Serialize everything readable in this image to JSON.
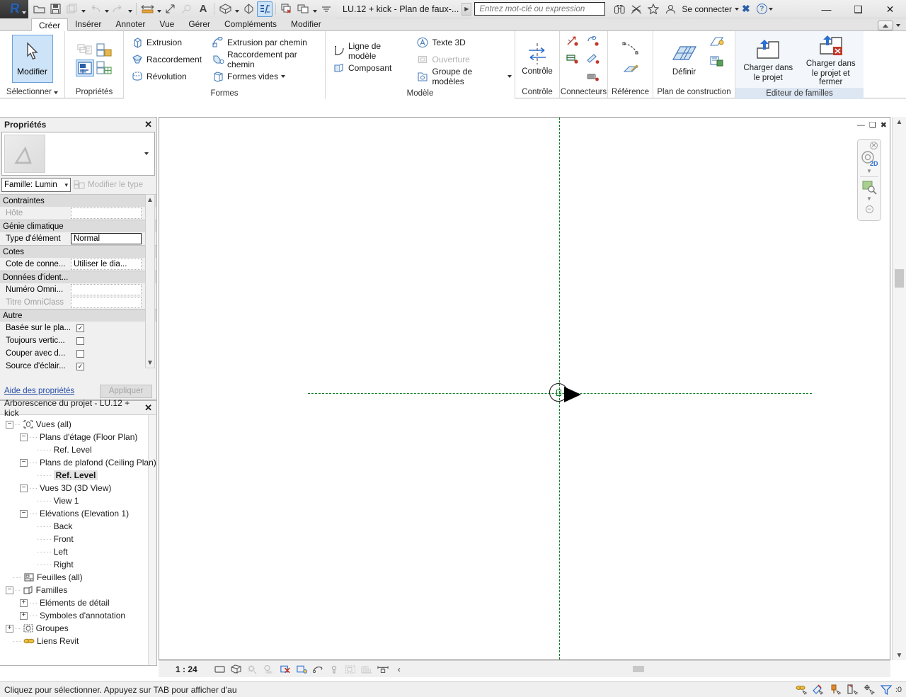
{
  "app": {
    "logo_glyph": "R",
    "document_title": "LU.12 + kick - Plan de faux-...",
    "sign_in_label": "Se connecter"
  },
  "quick_access": {
    "items": [
      {
        "name": "open-icon",
        "glyph": "⦗",
        "state": "enabled"
      },
      {
        "name": "save-icon",
        "glyph": "ὋE",
        "state": "enabled"
      },
      {
        "name": "save-as-icon",
        "glyph": "⎘",
        "state": "disabled"
      },
      {
        "name": "undo-icon",
        "glyph": "↶",
        "state": "disabled"
      },
      {
        "name": "redo-icon",
        "glyph": "↷",
        "state": "disabled"
      },
      {
        "name": "measure-icon",
        "glyph": "↔",
        "state": "enabled"
      },
      {
        "name": "aligned-dimension-icon",
        "glyph": "⤡",
        "state": "enabled"
      },
      {
        "name": "tag-icon",
        "glyph": "ⓘ",
        "state": "disabled"
      },
      {
        "name": "text-icon",
        "glyph": "A",
        "state": "enabled"
      },
      {
        "name": "default-3d-view-icon",
        "glyph": "⬡",
        "state": "enabled"
      },
      {
        "name": "section-icon",
        "glyph": "⬡",
        "state": "enabled"
      },
      {
        "name": "thin-lines-icon",
        "glyph": "≡",
        "state": "selected"
      },
      {
        "name": "close-hidden-windows-icon",
        "glyph": "❐",
        "state": "enabled"
      },
      {
        "name": "switch-windows-icon",
        "glyph": "⧉",
        "state": "enabled"
      }
    ]
  },
  "search": {
    "placeholder": "Entrez mot-clé ou expression",
    "value": ""
  },
  "tabs": {
    "items": [
      {
        "label": "Créer",
        "active": true
      },
      {
        "label": "Insérer",
        "active": false
      },
      {
        "label": "Annoter",
        "active": false
      },
      {
        "label": "Vue",
        "active": false
      },
      {
        "label": "Gérer",
        "active": false
      },
      {
        "label": "Compléments",
        "active": false
      },
      {
        "label": "Modifier",
        "active": false
      }
    ]
  },
  "ribbon": {
    "panels": [
      {
        "title": "Sélectionner",
        "has_dropdown": true,
        "big_button": {
          "label": "Modifier",
          "icon": "cursor-arrow-icon"
        }
      },
      {
        "title": "Propriétés",
        "icons": [
          {
            "name": "properties-palette-icon",
            "selected": false
          },
          {
            "name": "family-types-icon",
            "selected": false
          },
          {
            "name": "family-category-icon",
            "selected": true
          },
          {
            "name": "family-parameter-icon",
            "selected": false
          }
        ]
      },
      {
        "title": "Formes",
        "rows": [
          {
            "label": "Extrusion",
            "icon": "extrusion-icon",
            "disabled": false
          },
          {
            "label": "Raccordement",
            "icon": "blend-icon",
            "disabled": false
          },
          {
            "label": "Révolution",
            "icon": "revolve-icon",
            "disabled": false
          },
          {
            "label": "Extrusion par chemin",
            "icon": "sweep-icon",
            "disabled": false
          },
          {
            "label": "Raccordement par chemin",
            "icon": "swept-blend-icon",
            "disabled": false
          },
          {
            "label": "Formes vides",
            "icon": "void-forms-icon",
            "disabled": false,
            "dropdown": true
          }
        ]
      },
      {
        "title": "Modèle",
        "rows": [
          {
            "label": "Ligne de modèle",
            "icon": "model-line-icon",
            "disabled": false
          },
          {
            "label": "Composant",
            "icon": "component-icon",
            "disabled": false
          },
          {
            "label": "Texte 3D",
            "icon": "model-text-icon",
            "disabled": false
          },
          {
            "label": "Ouverture",
            "icon": "opening-icon",
            "disabled": true
          },
          {
            "label": "Groupe de modèles",
            "icon": "model-group-icon",
            "disabled": false,
            "dropdown": true
          }
        ]
      },
      {
        "title": "Contrôle",
        "big_button": {
          "label": "Contrôle",
          "icon": "control-flip-icon"
        }
      },
      {
        "title": "Connecteurs",
        "icons": [
          {
            "name": "electrical-connector-icon"
          },
          {
            "name": "duct-connector-icon"
          },
          {
            "name": "pipe-connector-icon"
          },
          {
            "name": "cable-tray-connector-icon"
          },
          {
            "name": "conduit-connector-icon"
          }
        ]
      },
      {
        "title": "Référence",
        "icons": [
          {
            "name": "reference-line-icon"
          },
          {
            "name": "reference-plane-icon"
          }
        ]
      },
      {
        "title": "Plan de construction",
        "big_button": {
          "label": "Définir",
          "icon": "set-work-plane-icon"
        },
        "icons": [
          {
            "name": "show-work-plane-icon"
          },
          {
            "name": "work-plane-viewer-icon"
          }
        ]
      },
      {
        "title": "Editeur de familles",
        "highlighted": true,
        "buttons": [
          {
            "label_line1": "Charger dans",
            "label_line2": "le projet",
            "icon": "load-into-project-icon"
          },
          {
            "label_line1": "Charger dans",
            "label_line2": "le projet et fermer",
            "icon": "load-into-project-and-close-icon"
          }
        ]
      }
    ]
  },
  "properties": {
    "title": "Propriétés",
    "close_label": "✕",
    "family_selector": "Famille: Lumin",
    "edit_type_label": "Modifier le type",
    "groups": [
      {
        "name": "Contraintes",
        "rows": [
          {
            "label": "Hôte",
            "value": "",
            "type": "text",
            "disabled": true
          }
        ]
      },
      {
        "name": "Génie climatique",
        "rows": [
          {
            "label": "Type d'élément",
            "value": "Normal",
            "type": "text-active",
            "disabled": false
          }
        ]
      },
      {
        "name": "Cotes",
        "rows": [
          {
            "label": "Cote de conne...",
            "value": "Utiliser le dia...",
            "type": "text",
            "disabled": false
          }
        ]
      },
      {
        "name": "Données d'ident...",
        "rows": [
          {
            "label": "Numéro Omni...",
            "value": "",
            "type": "text",
            "disabled": false
          },
          {
            "label": "Titre OmniClass",
            "value": "",
            "type": "text",
            "disabled": true
          }
        ]
      },
      {
        "name": "Autre",
        "rows": [
          {
            "label": "Basée sur le pla...",
            "value": "",
            "type": "checkbox",
            "checked": true
          },
          {
            "label": "Toujours vertic...",
            "value": "",
            "type": "checkbox",
            "checked": false
          },
          {
            "label": "Couper avec d...",
            "value": "",
            "type": "checkbox",
            "checked": false
          },
          {
            "label": "Source d'éclair...",
            "value": "",
            "type": "checkbox",
            "checked": true
          }
        ]
      }
    ],
    "help_link": "Aide des propriétés",
    "apply_button": "Appliquer"
  },
  "browser": {
    "title": "Arborescence du projet - LU.12 + kick",
    "close_label": "✕",
    "nodes": [
      {
        "label": "Vues (all)",
        "depth": 0,
        "expander": "-",
        "icon": "views-icon",
        "selected": false
      },
      {
        "label": "Plans d'étage (Floor Plan)",
        "depth": 1,
        "expander": "-",
        "icon": "",
        "selected": false
      },
      {
        "label": "Ref. Level",
        "depth": 2,
        "expander": "",
        "icon": "",
        "selected": false
      },
      {
        "label": "Plans de plafond (Ceiling Plan)",
        "depth": 1,
        "expander": "-",
        "icon": "",
        "selected": false
      },
      {
        "label": "Ref. Level",
        "depth": 2,
        "expander": "",
        "icon": "",
        "selected": true
      },
      {
        "label": "Vues 3D (3D View)",
        "depth": 1,
        "expander": "-",
        "icon": "",
        "selected": false
      },
      {
        "label": "View 1",
        "depth": 2,
        "expander": "",
        "icon": "",
        "selected": false
      },
      {
        "label": "Elévations (Elevation 1)",
        "depth": 1,
        "expander": "-",
        "icon": "",
        "selected": false
      },
      {
        "label": "Back",
        "depth": 2,
        "expander": "",
        "icon": "",
        "selected": false
      },
      {
        "label": "Front",
        "depth": 2,
        "expander": "",
        "icon": "",
        "selected": false
      },
      {
        "label": "Left",
        "depth": 2,
        "expander": "",
        "icon": "",
        "selected": false
      },
      {
        "label": "Right",
        "depth": 2,
        "expander": "",
        "icon": "",
        "selected": false
      },
      {
        "label": "Feuilles (all)",
        "depth": 0,
        "expander": "",
        "icon": "sheets-icon",
        "selected": false
      },
      {
        "label": "Familles",
        "depth": 0,
        "expander": "-",
        "icon": "families-icon",
        "selected": false
      },
      {
        "label": "Eléments de détail",
        "depth": 1,
        "expander": "+",
        "icon": "",
        "selected": false
      },
      {
        "label": "Symboles d'annotation",
        "depth": 1,
        "expander": "+",
        "icon": "",
        "selected": false
      },
      {
        "label": "Groupes",
        "depth": 0,
        "expander": "+",
        "icon": "groups-icon",
        "selected": false
      },
      {
        "label": "Liens Revit",
        "depth": 0,
        "expander": "",
        "icon": "revit-links-icon",
        "selected": false
      }
    ]
  },
  "view_controls": {
    "scale": "1 : 24",
    "icons": [
      {
        "name": "view-scale-icon"
      },
      {
        "name": "detail-level-icon"
      },
      {
        "name": "visual-style-icon"
      },
      {
        "name": "sun-path-icon"
      },
      {
        "name": "shadows-icon"
      },
      {
        "name": "render-dialog-icon"
      },
      {
        "name": "crop-view-icon"
      },
      {
        "name": "show-crop-region-icon"
      },
      {
        "name": "lock-3d-view-icon"
      },
      {
        "name": "temporary-hide-isolate-icon"
      },
      {
        "name": "reveal-hidden-elements-icon"
      },
      {
        "name": "analytical-model-icon"
      },
      {
        "name": "constraints-icon"
      },
      {
        "name": "expand-chevron-icon"
      }
    ]
  },
  "status": {
    "message": "Cliquez pour sélectionner. Appuyez sur TAB pour afficher d'au",
    "right_icons": [
      {
        "name": "select-links-icon"
      },
      {
        "name": "select-underlay-elements-icon"
      },
      {
        "name": "select-pinned-elements-icon"
      },
      {
        "name": "select-elements-by-face-icon"
      },
      {
        "name": "drag-elements-on-selection-icon"
      },
      {
        "name": "filter-icon"
      }
    ],
    "filter_count": ":0"
  },
  "canvas": {
    "reference_plane_color": "#0a7d28",
    "element_name": "light-source-symbol"
  }
}
